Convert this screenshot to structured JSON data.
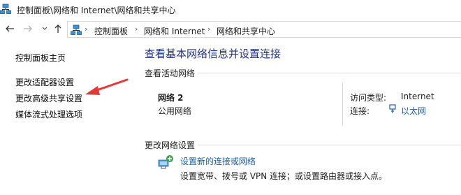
{
  "window": {
    "title": "控制面板\\网络和 Internet\\网络和共享中心"
  },
  "nav": {
    "back_icon": "back-arrow-icon",
    "forward_icon": "forward-arrow-icon",
    "recent_icon": "chevron-down-icon",
    "up_icon": "up-arrow-icon"
  },
  "breadcrumb": {
    "items": [
      "控制面板",
      "网络和 Internet",
      "网络和共享中心"
    ],
    "separator": "›"
  },
  "sidebar": {
    "items": [
      {
        "label": "控制面板主页"
      },
      {
        "label": "更改适配器设置"
      },
      {
        "label": "更改高级共享设置"
      },
      {
        "label": "媒体流式处理选项"
      }
    ]
  },
  "main": {
    "title": "查看基本网络信息并设置连接",
    "active_networks_heading": "查看活动网络",
    "network": {
      "name": "网络 2",
      "type": "公用网络",
      "access_type_label": "访问类型:",
      "access_type_value": "Internet",
      "connection_label": "连接:",
      "connection_value": "以太网"
    },
    "change_settings_heading": "更改网络设置",
    "setup": {
      "link": "设置新的连接或网络",
      "description": "设置宽带、拨号或 VPN 连接；或设置路由器或接入点。"
    }
  },
  "colors": {
    "title_blue": "#1e3287",
    "link_blue": "#1a5fb4",
    "annotation_red": "#e53935"
  }
}
